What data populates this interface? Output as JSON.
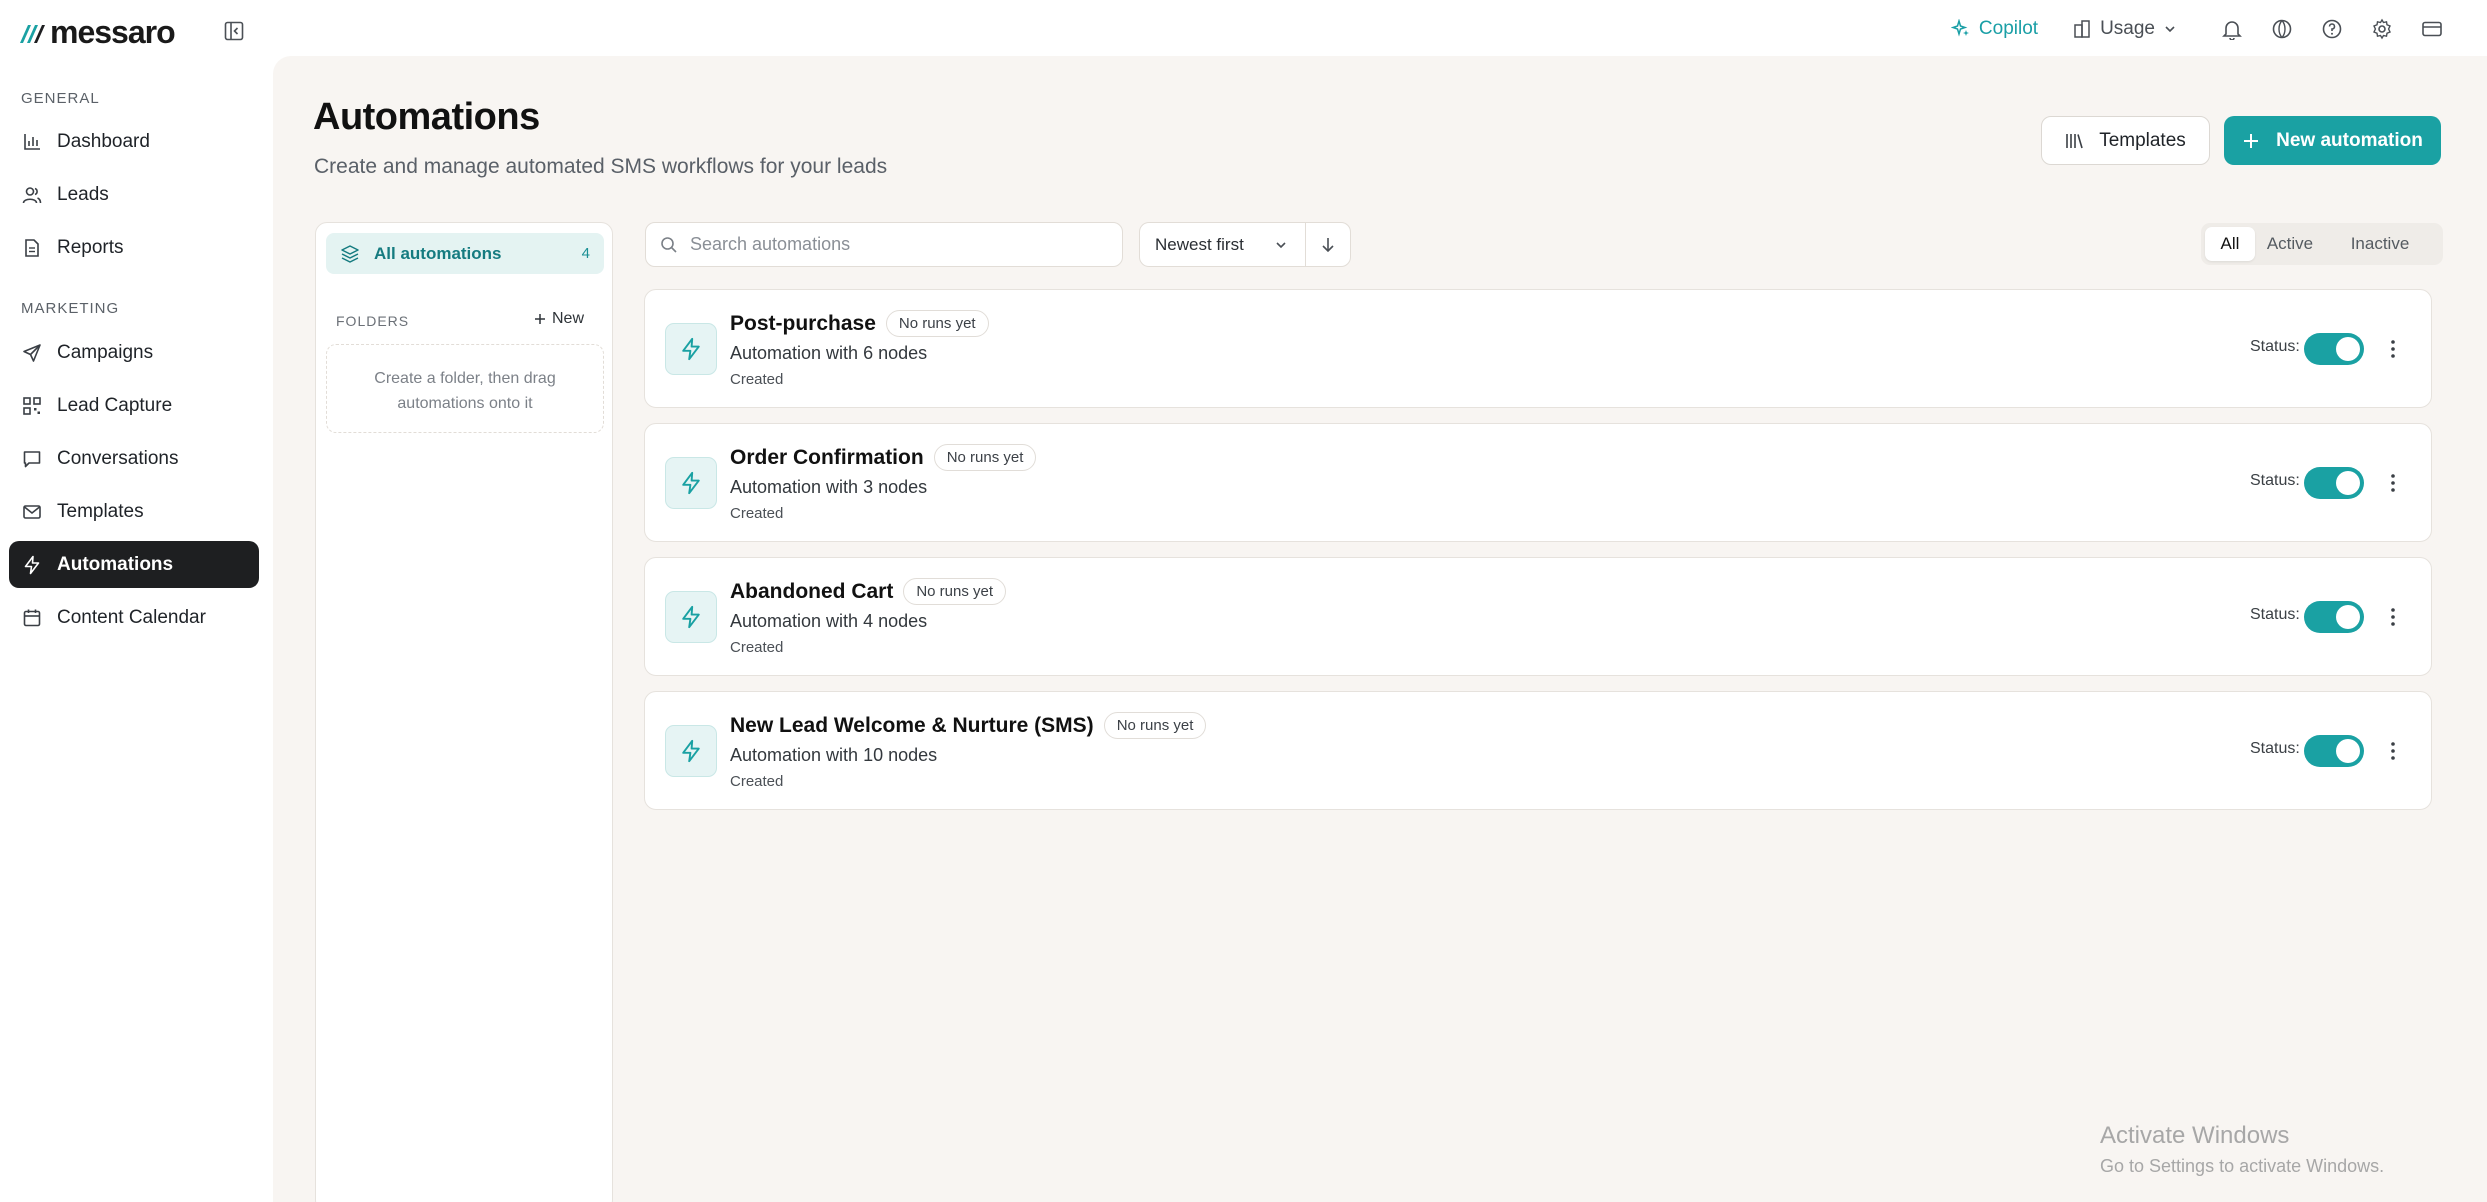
{
  "app": {
    "brand": "messaro",
    "brand_color": "#1aa1a3"
  },
  "topbar": {
    "copilot_label": "Copilot",
    "usage_label": "Usage",
    "icons": [
      "notifications-bell-icon",
      "language-globe-icon",
      "help-icon",
      "settings-gear-icon",
      "billing-card-icon"
    ]
  },
  "sidebar": {
    "general_label": "GENERAL",
    "marketing_label": "MARKETING",
    "general_items": [
      {
        "label": "Dashboard",
        "icon": "bar-chart-icon"
      },
      {
        "label": "Leads",
        "icon": "users-icon"
      },
      {
        "label": "Reports",
        "icon": "document-icon"
      }
    ],
    "marketing_items": [
      {
        "label": "Campaigns",
        "icon": "send-icon"
      },
      {
        "label": "Lead Capture",
        "icon": "qr-code-icon"
      },
      {
        "label": "Conversations",
        "icon": "chat-bubble-icon"
      },
      {
        "label": "Templates",
        "icon": "mail-icon"
      },
      {
        "label": "Automations",
        "icon": "lightning-icon",
        "active": true
      },
      {
        "label": "Content Calendar",
        "icon": "calendar-icon"
      }
    ]
  },
  "page": {
    "title": "Automations",
    "subtitle": "Create and manage automated SMS workflows for your leads",
    "templates_button": "Templates",
    "new_button": "New automation"
  },
  "folders": {
    "all_label": "All automations",
    "all_count": "4",
    "folders_label": "FOLDERS",
    "new_label": "New",
    "empty_line1": "Create a folder, then drag",
    "empty_line2": "automations onto it"
  },
  "toolbar": {
    "search_placeholder": "Search automations",
    "sort_value": "Newest first",
    "filters": [
      "All",
      "Active",
      "Inactive"
    ],
    "selected_filter": "All"
  },
  "automations": [
    {
      "name": "Post-purchase",
      "badge": "No runs yet",
      "description": "Automation with 6 nodes",
      "created": "Created",
      "status_label": "Status:",
      "enabled": true
    },
    {
      "name": "Order Confirmation",
      "badge": "No runs yet",
      "description": "Automation with 3 nodes",
      "created": "Created",
      "status_label": "Status:",
      "enabled": true
    },
    {
      "name": "Abandoned Cart",
      "badge": "No runs yet",
      "description": "Automation with 4 nodes",
      "created": "Created",
      "status_label": "Status:",
      "enabled": true
    },
    {
      "name": "New Lead Welcome & Nurture (SMS)",
      "badge": "No runs yet",
      "description": "Automation with 10 nodes",
      "created": "Created",
      "status_label": "Status:",
      "enabled": true
    }
  ],
  "watermark": {
    "title": "Activate Windows",
    "subtitle": "Go to Settings to activate Windows."
  }
}
